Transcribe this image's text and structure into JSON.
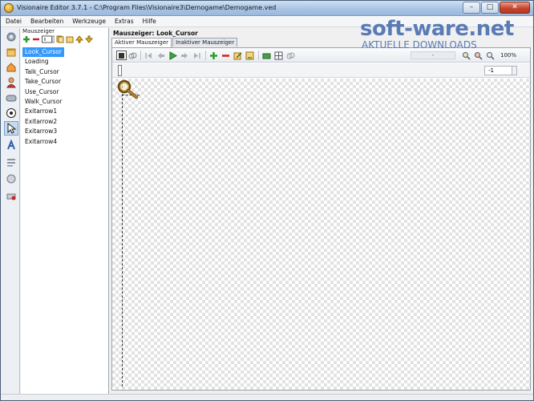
{
  "window": {
    "title": "Visionaire Editor 3.7.1 - C:\\Program Files\\Visionaire3\\Demogame\\Demogame.ved",
    "buttons": {
      "minimize": "–",
      "maximize": "□",
      "close": "✕"
    }
  },
  "menubar": {
    "items": [
      {
        "label": "Datei"
      },
      {
        "label": "Bearbeiten"
      },
      {
        "label": "Werkzeuge"
      },
      {
        "label": "Extras"
      },
      {
        "label": "Hilfe"
      }
    ]
  },
  "left_panel": {
    "title": "Mauszeiger",
    "items": [
      {
        "label": "Look_Cursor",
        "selected": true
      },
      {
        "label": "Loading"
      },
      {
        "label": "Talk_Cursor"
      },
      {
        "label": "Take_Cursor"
      },
      {
        "label": "Use_Cursor"
      },
      {
        "label": "Walk_Cursor"
      },
      {
        "label": "Exitarrow1"
      },
      {
        "label": "Exitarrow2"
      },
      {
        "label": "Exitarrow3"
      },
      {
        "label": "Exitarrow4"
      }
    ]
  },
  "main": {
    "title": "Mauszeiger: Look_Cursor",
    "tabs": [
      {
        "label": "Aktiver Mauszeiger",
        "active": true
      },
      {
        "label": "Inaktiver Mauszeiger"
      }
    ],
    "toolbar": {
      "dash_field": "-",
      "zoom": "100%"
    },
    "frame_input": "-1"
  },
  "watermark": {
    "main": "soft-ware.net",
    "sub": "AKTUELLE DOWNLOADS"
  },
  "colors": {
    "selection": "#3399ff",
    "add_green": "#2e9a2e",
    "remove_red": "#d02020",
    "brand_blue": "#4a6fb0"
  }
}
